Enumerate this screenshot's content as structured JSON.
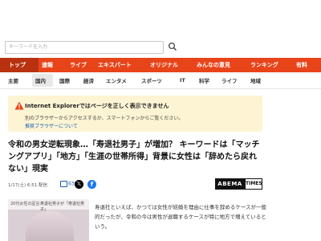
{
  "search": {
    "placeholder": "キーワードを入力"
  },
  "nav_main": [
    {
      "label": "トップ",
      "active": true
    },
    {
      "label": "速報"
    },
    {
      "label": "ライブ"
    },
    {
      "label": "エキスパート"
    },
    {
      "label": "オリジナル"
    },
    {
      "label": "みんなの意見"
    },
    {
      "label": "ランキング"
    },
    {
      "label": "有料"
    }
  ],
  "nav_sub": [
    {
      "label": "主要"
    },
    {
      "label": "国内",
      "active": true
    },
    {
      "label": "国際"
    },
    {
      "label": "経済"
    },
    {
      "label": "エンタメ"
    },
    {
      "label": "スポーツ"
    },
    {
      "label": "IT"
    },
    {
      "label": "科学"
    },
    {
      "label": "ライフ"
    },
    {
      "label": "地域"
    }
  ],
  "warning": {
    "title": "Internet Explorerではページを正しく表示できません",
    "text": "別のブラウザーからアクセスするか、スマートフォンからご覧ください。",
    "link": "推奨ブラウザーについて"
  },
  "article": {
    "headline": "令和の男女逆転現象…「寿退社男子」が増加？ キーワードは「マッチングアプリ」「地方」「生涯の世帯所得」背景に女性は「辞めたら戻れない」現実",
    "date": "1/17(土) 6:51 配信",
    "comments": "630",
    "source_logo": {
      "a": "ABEMA",
      "b": "TIMES"
    },
    "thumb_caption_1": "20代女性の証言",
    "thumb_caption_2": "寿退社男子が「寿退社男子」",
    "body": "寿退社といえば、かつては女性が結婚を理由に仕事を辞めるケースが一般的だったが、令和の今は男性が退職するケースが特に地方で増えているという。"
  },
  "colors": {
    "accent": "#e8441a",
    "accent_dark": "#b9320f",
    "warning_bg": "#fdf4d4",
    "link": "#1a5fb4"
  }
}
